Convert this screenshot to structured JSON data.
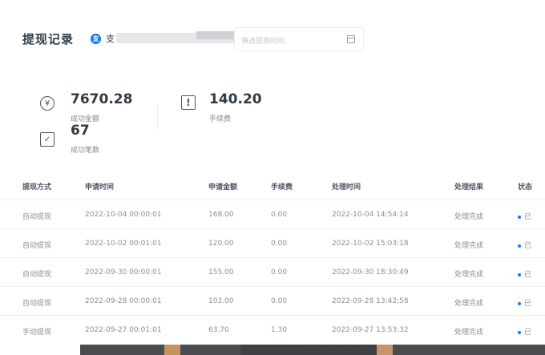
{
  "header": {
    "title": "提现记录",
    "account_name": "支",
    "date_placeholder": "筛选提现时间"
  },
  "stats": {
    "amount_value": "7670.28",
    "amount_label": "成功金额",
    "fee_value": "140.20",
    "fee_label": "手续费",
    "count_value": "67",
    "count_label": "成功笔数"
  },
  "table": {
    "columns": [
      "提现方式",
      "申请时间",
      "申请金额",
      "手续费",
      "处理时间",
      "处理结果",
      "状态"
    ],
    "rows": [
      {
        "method": "自动提现",
        "apply_time": "2022-10-04 00:00:01",
        "amount": "168.00",
        "fee": "0.00",
        "process_time": "2022-10-04 14:54:14",
        "result": "处理完成",
        "status": "已"
      },
      {
        "method": "自动提现",
        "apply_time": "2022-10-02 00:01:01",
        "amount": "120.00",
        "fee": "0.00",
        "process_time": "2022-10-02 15:03:18",
        "result": "处理完成",
        "status": "已"
      },
      {
        "method": "自动提现",
        "apply_time": "2022-09-30 00:00:01",
        "amount": "155.00",
        "fee": "0.00",
        "process_time": "2022-09-30 18:30:49",
        "result": "处理完成",
        "status": "已"
      },
      {
        "method": "自动提现",
        "apply_time": "2022-09-28 00:00:01",
        "amount": "103.00",
        "fee": "0.00",
        "process_time": "2022-09-28 13:42:58",
        "result": "处理完成",
        "status": "已"
      },
      {
        "method": "手动提现",
        "apply_time": "2022-09-27 00:01:01",
        "amount": "63.70",
        "fee": "1.30",
        "process_time": "2022-09-27 13:53:32",
        "result": "处理完成",
        "status": "已"
      }
    ]
  },
  "colors": {
    "accent": "#1677ff",
    "title_text": "#2f3a45"
  },
  "icons": {
    "account": "alipay-icon",
    "date": "calendar-icon",
    "amount": "yen-icon",
    "fee": "fee-icon",
    "count": "count-icon"
  }
}
